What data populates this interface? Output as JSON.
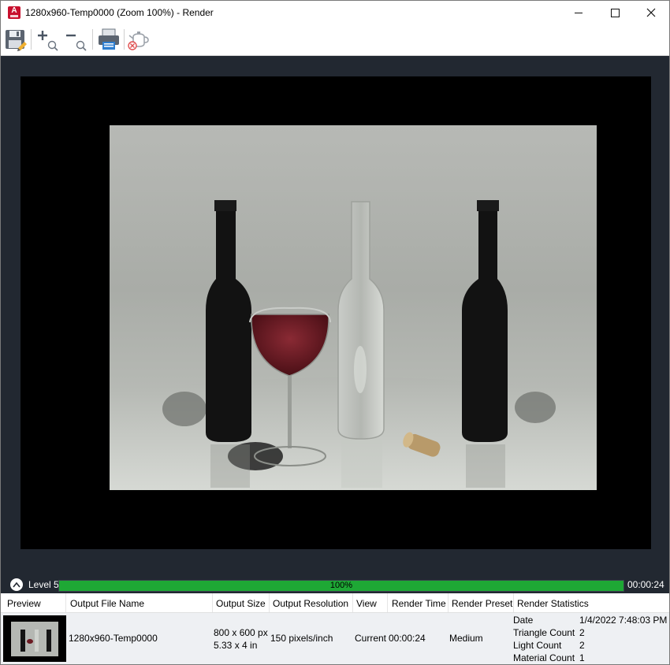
{
  "window": {
    "title": "1280x960-Temp0000 (Zoom 100%) - Render",
    "app_icon_letter": "A"
  },
  "toolbar": {
    "buttons": [
      "save-icon",
      "zoom-in-icon",
      "zoom-out-icon",
      "print-icon",
      "cancel-render-icon"
    ]
  },
  "progress": {
    "level_label": "Level 5",
    "percent_text": "100%",
    "percent": 100,
    "elapsed": "00:00:24",
    "fill_color": "#1ea835"
  },
  "history": {
    "columns": [
      "Preview",
      "Output File Name",
      "Output Size",
      "Output Resolution",
      "View",
      "Render Time",
      "Render Preset",
      "Render Statistics"
    ],
    "row": {
      "file_name": "1280x960-Temp0000",
      "output_size_line1": "800 x 600 px",
      "output_size_line2": "5.33 x 4 in",
      "resolution": "150 pixels/inch",
      "view": "Current",
      "render_time": "00:00:24",
      "preset": "Medium",
      "stats": [
        {
          "label": "Date",
          "value": "1/4/2022 7:48:03 PM"
        },
        {
          "label": "Triangle Count",
          "value": "2"
        },
        {
          "label": "Light Count",
          "value": "2"
        },
        {
          "label": "Material Count",
          "value": "1"
        }
      ]
    }
  }
}
